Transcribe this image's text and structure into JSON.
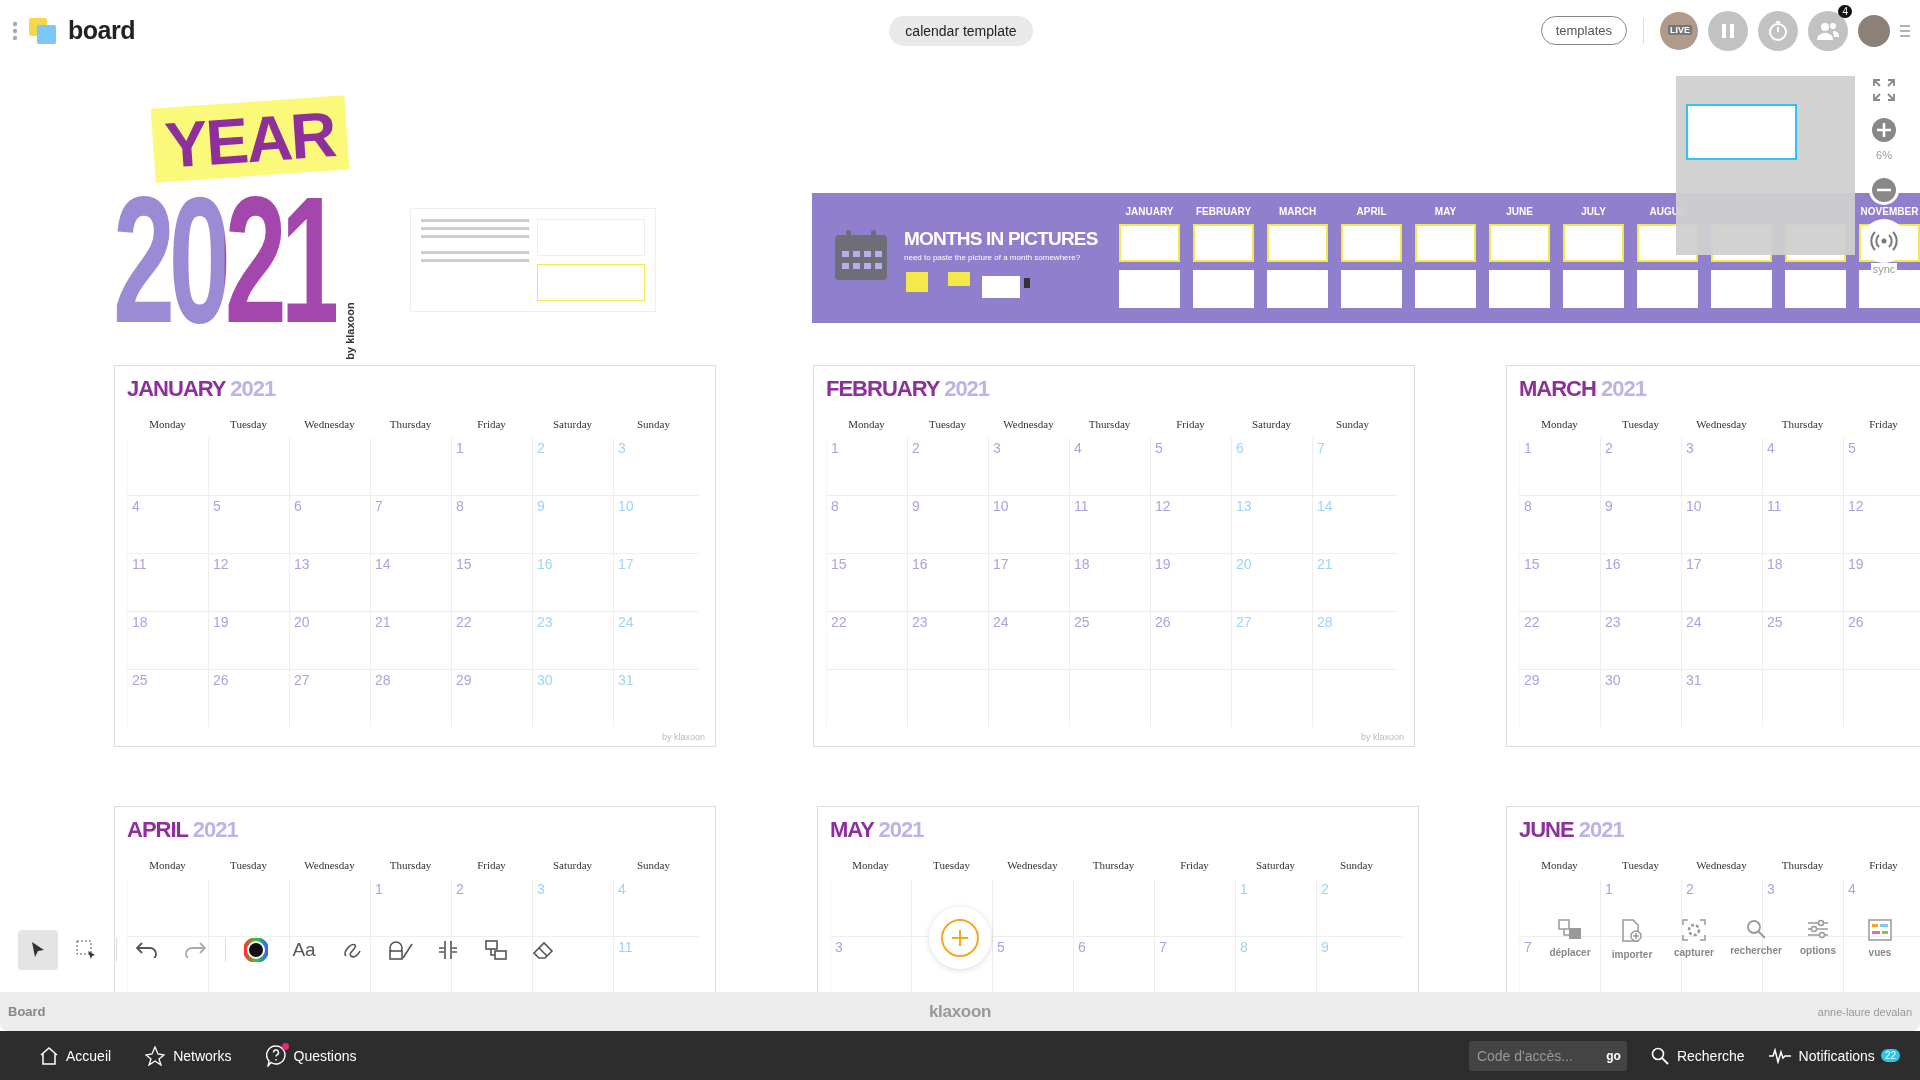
{
  "top_bar": {
    "app_name": "board",
    "board_name": "calendar template",
    "templates_button": "templates",
    "live_badge": "LIVE",
    "participants_count": "4"
  },
  "year_logo": {
    "year_word": "YEAR",
    "year_number": "2021",
    "byline": "by klaxoon"
  },
  "months_banner": {
    "title": "MONTHS IN PICTURES",
    "subtitle": "need to paste the picture of a month somewhere?",
    "months": [
      {
        "label": "JANUARY"
      },
      {
        "label": "FEBRUARY"
      },
      {
        "label": "MARCH"
      },
      {
        "label": "APRIL"
      },
      {
        "label": "MAY"
      },
      {
        "label": "JUNE"
      },
      {
        "label": "JULY"
      },
      {
        "label": "AUGUS"
      },
      {
        "covered": true
      },
      {
        "covered": true
      },
      {
        "label": "NOVEMBER"
      }
    ]
  },
  "calendars": [
    {
      "month": "JANUARY",
      "year": "2021",
      "footer": "by klaxoon",
      "weekdays": [
        "Monday",
        "Tuesday",
        "Wednesday",
        "Thursday",
        "Friday",
        "Saturday",
        "Sunday"
      ],
      "weeks": [
        [
          {
            "blank": true
          },
          {
            "blank": true
          },
          {
            "blank": true
          },
          {
            "blank": true
          },
          {
            "day": "1",
            "weekend": false
          },
          {
            "day": "2",
            "weekend": true
          },
          {
            "day": "3",
            "weekend": true
          }
        ],
        [
          {
            "day": "4",
            "weekend": false
          },
          {
            "day": "5",
            "weekend": false
          },
          {
            "day": "6",
            "weekend": false
          },
          {
            "day": "7",
            "weekend": false
          },
          {
            "day": "8",
            "weekend": false
          },
          {
            "day": "9",
            "weekend": true
          },
          {
            "day": "10",
            "weekend": true
          }
        ],
        [
          {
            "day": "11",
            "weekend": false
          },
          {
            "day": "12",
            "weekend": false
          },
          {
            "day": "13",
            "weekend": false
          },
          {
            "day": "14",
            "weekend": false
          },
          {
            "day": "15",
            "weekend": false
          },
          {
            "day": "16",
            "weekend": true
          },
          {
            "day": "17",
            "weekend": true
          }
        ],
        [
          {
            "day": "18",
            "weekend": false
          },
          {
            "day": "19",
            "weekend": false
          },
          {
            "day": "20",
            "weekend": false
          },
          {
            "day": "21",
            "weekend": false
          },
          {
            "day": "22",
            "weekend": false
          },
          {
            "day": "23",
            "weekend": true
          },
          {
            "day": "24",
            "weekend": true
          }
        ],
        [
          {
            "day": "25",
            "weekend": false
          },
          {
            "day": "26",
            "weekend": false
          },
          {
            "day": "27",
            "weekend": false
          },
          {
            "day": "28",
            "weekend": false
          },
          {
            "day": "29",
            "weekend": false
          },
          {
            "day": "30",
            "weekend": true
          },
          {
            "day": "31",
            "weekend": true
          }
        ]
      ]
    },
    {
      "month": "FEBRUARY",
      "year": "2021",
      "footer": "by klaxoon",
      "weekdays": [
        "Monday",
        "Tuesday",
        "Wednesday",
        "Thursday",
        "Friday",
        "Saturday",
        "Sunday"
      ],
      "weeks": [
        [
          {
            "day": "1",
            "weekend": false
          },
          {
            "day": "2",
            "weekend": false
          },
          {
            "day": "3",
            "weekend": false
          },
          {
            "day": "4",
            "weekend": false
          },
          {
            "day": "5",
            "weekend": false
          },
          {
            "day": "6",
            "weekend": true
          },
          {
            "day": "7",
            "weekend": true
          }
        ],
        [
          {
            "day": "8",
            "weekend": false
          },
          {
            "day": "9",
            "weekend": false
          },
          {
            "day": "10",
            "weekend": false
          },
          {
            "day": "11",
            "weekend": false
          },
          {
            "day": "12",
            "weekend": false
          },
          {
            "day": "13",
            "weekend": true
          },
          {
            "day": "14",
            "weekend": true
          }
        ],
        [
          {
            "day": "15",
            "weekend": false
          },
          {
            "day": "16",
            "weekend": false
          },
          {
            "day": "17",
            "weekend": false
          },
          {
            "day": "18",
            "weekend": false
          },
          {
            "day": "19",
            "weekend": false
          },
          {
            "day": "20",
            "weekend": true
          },
          {
            "day": "21",
            "weekend": true
          }
        ],
        [
          {
            "day": "22",
            "weekend": false
          },
          {
            "day": "23",
            "weekend": false
          },
          {
            "day": "24",
            "weekend": false
          },
          {
            "day": "25",
            "weekend": false
          },
          {
            "day": "26",
            "weekend": false
          },
          {
            "day": "27",
            "weekend": true
          },
          {
            "day": "28",
            "weekend": true
          }
        ],
        [
          {
            "blank": true
          },
          {
            "blank": true
          },
          {
            "blank": true
          },
          {
            "blank": true
          },
          {
            "blank": true
          },
          {
            "blank": true
          },
          {
            "blank": true
          }
        ]
      ]
    },
    {
      "month": "MARCH",
      "year": "2021",
      "weekdays": [
        "Monday",
        "Tuesday",
        "Wednesday",
        "Thursday",
        "Friday"
      ],
      "weeks": [
        [
          {
            "day": "1",
            "weekend": false
          },
          {
            "day": "2",
            "weekend": false
          },
          {
            "day": "3",
            "weekend": false
          },
          {
            "day": "4",
            "weekend": false
          },
          {
            "day": "5",
            "weekend": false
          }
        ],
        [
          {
            "day": "8",
            "weekend": false
          },
          {
            "day": "9",
            "weekend": false
          },
          {
            "day": "10",
            "weekend": false
          },
          {
            "day": "11",
            "weekend": false
          },
          {
            "day": "12",
            "weekend": false
          }
        ],
        [
          {
            "day": "15",
            "weekend": false
          },
          {
            "day": "16",
            "weekend": false
          },
          {
            "day": "17",
            "weekend": false
          },
          {
            "day": "18",
            "weekend": false
          },
          {
            "day": "19",
            "weekend": false
          }
        ],
        [
          {
            "day": "22",
            "weekend": false
          },
          {
            "day": "23",
            "weekend": false
          },
          {
            "day": "24",
            "weekend": false
          },
          {
            "day": "25",
            "weekend": false
          },
          {
            "day": "26",
            "weekend": false
          }
        ],
        [
          {
            "day": "29",
            "weekend": false
          },
          {
            "day": "30",
            "weekend": false
          },
          {
            "day": "31",
            "weekend": false
          },
          {
            "blank": true
          },
          {
            "blank": true
          }
        ]
      ]
    },
    {
      "month": "APRIL",
      "year": "2021",
      "weekdays": [
        "Monday",
        "Tuesday",
        "Wednesday",
        "Thursday",
        "Friday",
        "Saturday",
        "Sunday"
      ],
      "weeks": [
        [
          {
            "blank": true
          },
          {
            "blank": true
          },
          {
            "blank": true
          },
          {
            "day": "1",
            "weekend": false
          },
          {
            "day": "2",
            "weekend": false
          },
          {
            "day": "3",
            "weekend": true
          },
          {
            "day": "4",
            "weekend": true
          }
        ],
        [
          {
            "blank": true
          },
          {
            "blank": true
          },
          {
            "blank": true
          },
          {
            "blank": true
          },
          {
            "blank": true
          },
          {
            "blank": true
          },
          {
            "day": "11",
            "weekend": true
          }
        ]
      ]
    },
    {
      "month": "MAY",
      "year": "2021",
      "weekdays": [
        "Monday",
        "Tuesday",
        "Wednesday",
        "Thursday",
        "Friday",
        "Saturday",
        "Sunday"
      ],
      "weeks": [
        [
          {
            "blank": true
          },
          {
            "blank": true
          },
          {
            "blank": true
          },
          {
            "blank": true
          },
          {
            "blank": true
          },
          {
            "day": "1",
            "weekend": true
          },
          {
            "day": "2",
            "weekend": true
          }
        ],
        [
          {
            "day": "3",
            "weekend": false
          },
          {
            "blank": true
          },
          {
            "day": "5",
            "weekend": false
          },
          {
            "day": "6",
            "weekend": false
          },
          {
            "day": "7",
            "weekend": false
          },
          {
            "day": "8",
            "weekend": true
          },
          {
            "day": "9",
            "weekend": true
          }
        ]
      ]
    },
    {
      "month": "JUNE",
      "year": "2021",
      "weekdays": [
        "Monday",
        "Tuesday",
        "Wednesday",
        "Thursday",
        "Friday"
      ],
      "weeks": [
        [
          {
            "blank": true
          },
          {
            "day": "1",
            "weekend": false
          },
          {
            "day": "2",
            "weekend": false
          },
          {
            "day": "3",
            "weekend": false
          },
          {
            "day": "4",
            "weekend": false
          }
        ],
        [
          {
            "day": "7",
            "weekend": false
          },
          {
            "blank": true
          },
          {
            "blank": true
          },
          {
            "blank": true
          },
          {
            "blank": true
          }
        ]
      ]
    }
  ],
  "zoom_controls": {
    "zoom_level": "6%",
    "sync_label": "sync"
  },
  "tools": [
    {
      "kind": "select",
      "selected": true
    },
    {
      "kind": "marquee",
      "selected": false
    },
    {
      "kind": "undo",
      "selected": false
    },
    {
      "kind": "redo",
      "selected": false
    },
    {
      "kind": "color",
      "selected": false
    },
    {
      "kind": "text",
      "label": "Aa",
      "selected": false
    },
    {
      "kind": "pen",
      "selected": false
    },
    {
      "kind": "shapes",
      "selected": false
    },
    {
      "kind": "grid",
      "selected": false
    },
    {
      "kind": "connector",
      "selected": false
    },
    {
      "kind": "eraser",
      "selected": false
    }
  ],
  "actions": [
    {
      "kind": "move",
      "label": "déplacer"
    },
    {
      "kind": "import",
      "label": "importer"
    },
    {
      "kind": "capture",
      "label": "capturer"
    },
    {
      "kind": "search",
      "label": "rechercher"
    },
    {
      "kind": "options",
      "label": "options"
    },
    {
      "kind": "views",
      "label": "vues"
    }
  ],
  "status_bar": {
    "left": "Board",
    "center": "klaxoon",
    "user": "anne-laure devalan"
  },
  "nav": {
    "items": [
      {
        "kind": "home",
        "label": "Accueil",
        "alert": false
      },
      {
        "kind": "networks",
        "label": "Networks",
        "alert": false
      },
      {
        "kind": "questions",
        "label": "Questions",
        "alert": true
      }
    ],
    "access_field": {
      "placeholder": "Code d'accès...",
      "button": "go"
    },
    "search": "Recherche",
    "notifications": "Notifications",
    "notifications_count": "22"
  }
}
